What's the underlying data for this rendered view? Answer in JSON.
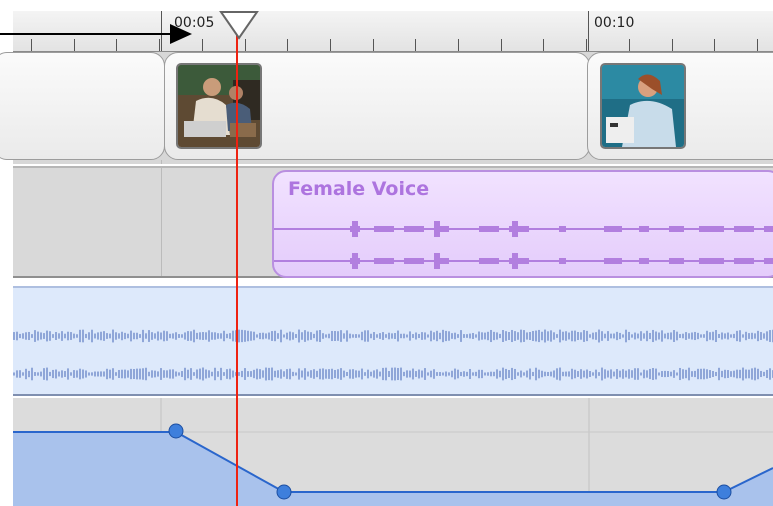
{
  "ruler": {
    "labels": [
      "00:05",
      "00:10"
    ]
  },
  "voice_track": {
    "clip_name": "Female Voice"
  },
  "colors": {
    "playhead": "#ee2211",
    "voice_clip": "#e4ccfb",
    "voice_label": "#ad74df",
    "music_wave": "#8fa6d8",
    "volume_fill": "#a9c2ec",
    "volume_line": "#2a66cc"
  },
  "icons": {
    "playhead": "playhead-triangle-icon",
    "annotation": "arrow-right-icon"
  }
}
